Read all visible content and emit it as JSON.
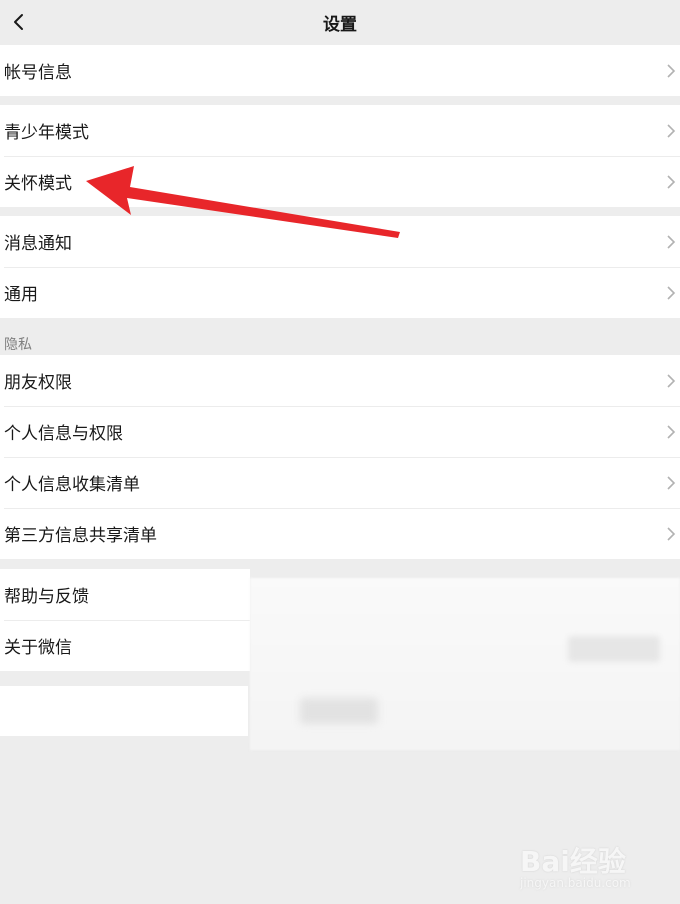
{
  "nav": {
    "title": "设置"
  },
  "groups": [
    {
      "items": [
        {
          "label": "帐号信息"
        }
      ]
    },
    {
      "items": [
        {
          "label": "青少年模式"
        },
        {
          "label": "关怀模式"
        }
      ]
    },
    {
      "items": [
        {
          "label": "消息通知"
        },
        {
          "label": "通用"
        }
      ]
    },
    {
      "items": [
        {
          "label": "朋友权限"
        },
        {
          "label": "个人信息与权限"
        },
        {
          "label": "个人信息收集清单"
        },
        {
          "label": "第三方信息共享清单"
        }
      ]
    },
    {
      "items": [
        {
          "label": "帮助与反馈"
        },
        {
          "label": "关于微信"
        }
      ]
    }
  ],
  "privacy_section": {
    "label": "隐私"
  },
  "annotation": {
    "color": "#e8262a",
    "points_to": "关怀模式"
  },
  "watermark": {
    "logo": "Bai经验",
    "sub": "jingyan.baidu.com"
  },
  "icons": {
    "back": "chevron-left-icon",
    "row": "chevron-right-icon"
  }
}
